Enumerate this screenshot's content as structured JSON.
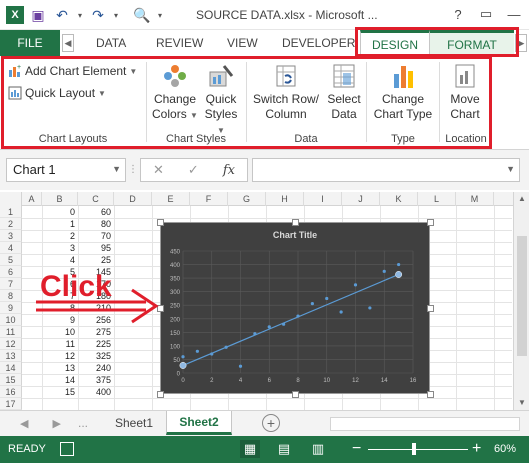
{
  "window": {
    "title": "SOURCE DATA.xlsx - Microsoft ...",
    "help": "?",
    "restore": "▭",
    "minimize": "—"
  },
  "qat": {
    "save_icon": "save-icon",
    "undo_icon": "undo-icon",
    "redo_icon": "redo-icon",
    "preview_icon": "print-preview-icon"
  },
  "tabs": {
    "file": "FILE",
    "items": [
      "DATA",
      "REVIEW",
      "VIEW",
      "DEVELOPER"
    ],
    "context": [
      "DESIGN",
      "FORMAT"
    ],
    "active": "DESIGN"
  },
  "ribbon": {
    "chart_layouts": {
      "add_chart_element": "Add Chart Element",
      "quick_layout": "Quick Layout",
      "label": "Chart Layouts"
    },
    "chart_styles": {
      "change_colors_1": "Change",
      "change_colors_2": "Colors",
      "quick_styles_1": "Quick",
      "quick_styles_2": "Styles",
      "label": "Chart Styles"
    },
    "data": {
      "switch_1": "Switch Row/",
      "switch_2": "Column",
      "select_1": "Select",
      "select_2": "Data",
      "label": "Data"
    },
    "type": {
      "change_1": "Change",
      "change_2": "Chart Type",
      "label": "Type"
    },
    "location": {
      "move_1": "Move",
      "move_2": "Chart",
      "label": "Location"
    }
  },
  "formula_bar": {
    "name_box": "Chart 1",
    "cancel": "✕",
    "enter": "✓",
    "fx": "fx",
    "value": ""
  },
  "grid": {
    "columns": [
      "A",
      "B",
      "C",
      "D",
      "E",
      "F",
      "G",
      "H",
      "I",
      "J",
      "K",
      "L",
      "M"
    ],
    "rows": [
      {
        "n": "1",
        "a": "0",
        "b": "60"
      },
      {
        "n": "2",
        "a": "1",
        "b": "80"
      },
      {
        "n": "3",
        "a": "2",
        "b": "70"
      },
      {
        "n": "4",
        "a": "3",
        "b": "95"
      },
      {
        "n": "5",
        "a": "4",
        "b": "25"
      },
      {
        "n": "6",
        "a": "5",
        "b": "145"
      },
      {
        "n": "7",
        "a": "6",
        "b": "170"
      },
      {
        "n": "8",
        "a": "7",
        "b": "180"
      },
      {
        "n": "9",
        "a": "8",
        "b": "210"
      },
      {
        "n": "10",
        "a": "9",
        "b": "256"
      },
      {
        "n": "11",
        "a": "10",
        "b": "275"
      },
      {
        "n": "12",
        "a": "11",
        "b": "225"
      },
      {
        "n": "13",
        "a": "12",
        "b": "325"
      },
      {
        "n": "14",
        "a": "13",
        "b": "240"
      },
      {
        "n": "15",
        "a": "14",
        "b": "375"
      },
      {
        "n": "16",
        "a": "15",
        "b": "400"
      },
      {
        "n": "17",
        "a": "",
        "b": ""
      }
    ]
  },
  "annotation": {
    "click_label": "Click",
    "highlight_color": "#e01e2b"
  },
  "sheets": {
    "nav_left": "◀",
    "nav_right": "▶",
    "nav_more": "...",
    "tabs": [
      "Sheet1",
      "Sheet2"
    ],
    "active": "Sheet2",
    "add": "+"
  },
  "status": {
    "ready": "READY",
    "zoom_minus": "−",
    "zoom_plus": "+",
    "zoom": "60%",
    "zoom_level_pct": 60
  },
  "colors": {
    "excel_green": "#217346",
    "chart_bg": "#404040",
    "point_color": "#5b9bd5",
    "trendline_color": "#5b9bd5"
  },
  "chart_data": {
    "type": "scatter",
    "title": "Chart Title",
    "x": [
      0,
      1,
      2,
      3,
      4,
      5,
      6,
      7,
      8,
      9,
      10,
      11,
      12,
      13,
      14,
      15
    ],
    "y": [
      60,
      80,
      70,
      95,
      25,
      145,
      170,
      180,
      210,
      256,
      275,
      225,
      325,
      240,
      375,
      400
    ],
    "xlim": [
      0,
      16
    ],
    "ylim": [
      0,
      450
    ],
    "x_ticks": [
      0,
      2,
      4,
      6,
      8,
      10,
      12,
      14,
      16
    ],
    "y_ticks": [
      0,
      50,
      100,
      150,
      200,
      250,
      300,
      350,
      400,
      450
    ],
    "trendline": "linear",
    "grid": true,
    "legend": "none"
  }
}
